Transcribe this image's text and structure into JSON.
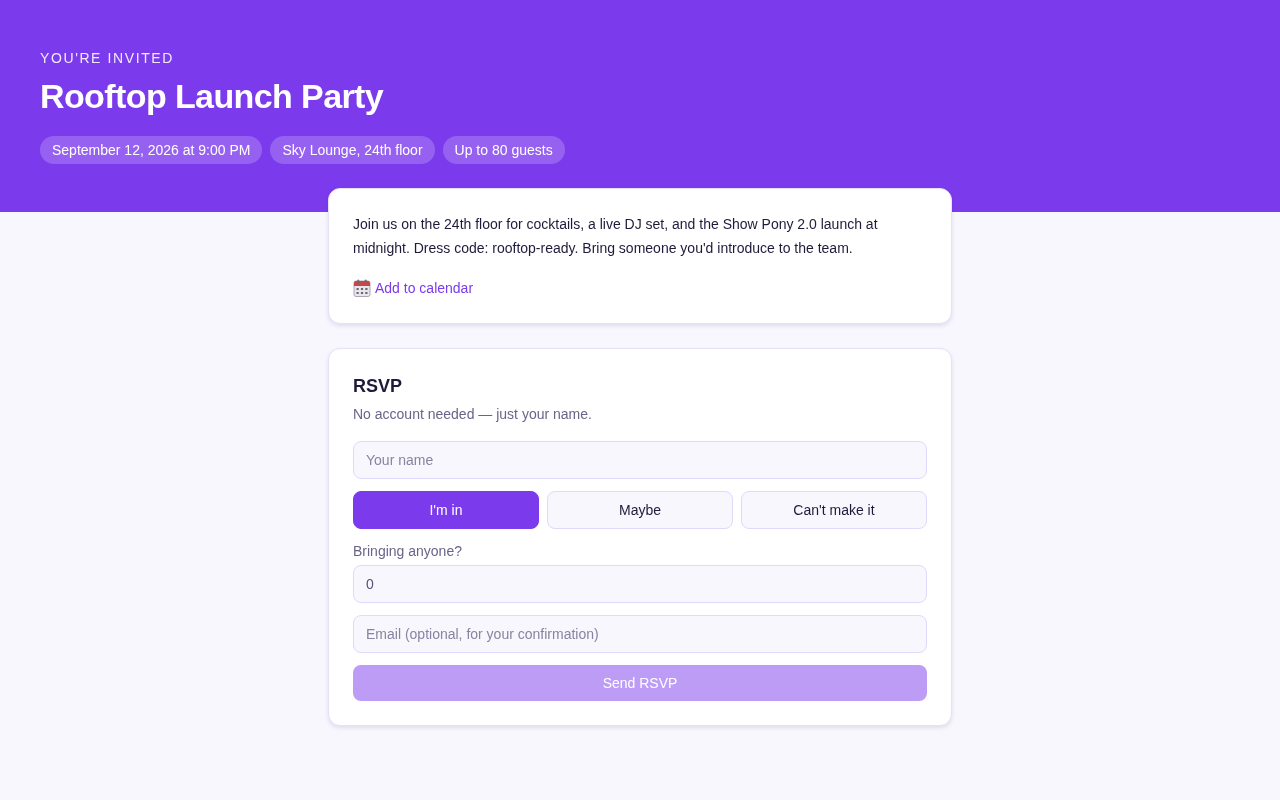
{
  "header": {
    "eyebrow": "YOU'RE INVITED",
    "title": "Rooftop Launch Party",
    "chips": [
      "September 12, 2026 at 9:00 PM",
      "Sky Lounge, 24th floor",
      "Up to 80 guests"
    ]
  },
  "details": {
    "description": "Join us on the 24th floor for cocktails, a live DJ set, and the Show Pony 2.0 launch at midnight. Dress code: rooftop-ready. Bring someone you'd introduce to the team.",
    "calendar_link": "Add to calendar"
  },
  "rsvp": {
    "title": "RSVP",
    "subtitle": "No account needed — just your name.",
    "name_field": {
      "placeholder": "Your name"
    },
    "options": [
      {
        "label": "I'm in",
        "selected": true
      },
      {
        "label": "Maybe",
        "selected": false
      },
      {
        "label": "Can't make it",
        "selected": false
      }
    ],
    "guests_label": "Bringing anyone?",
    "guests_field": {
      "value": "0"
    },
    "email_field": {
      "placeholder": "Email (optional, for your confirmation)"
    },
    "submit": {
      "label": "Send RSVP",
      "disabled": true
    }
  }
}
